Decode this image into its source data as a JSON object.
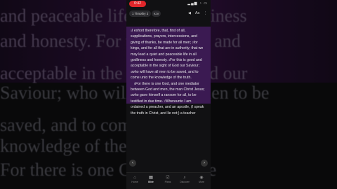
{
  "background": {
    "lines": [
      "and peaceable life in all godliness",
      "and honesty. For this is good and",
      "acceptable in the sight of God our",
      "Saviour; who will have all men to be",
      "saved, and to come unto the",
      "knowledge of the truth.",
      "For there is one God, and one"
    ]
  },
  "status": {
    "recording": "0:42",
    "icons": "▂▄▆ ◔ ▭"
  },
  "toolbar": {
    "reference": "1 Timothy 2",
    "version": "KJV",
    "icons": [
      "speaker-icon",
      "text-size-icon",
      "more-icon"
    ]
  },
  "verses": [
    {
      "num": "1",
      "text": "I exhort therefore, that, first of all, supplications, prayers, intercessions, and giving of thanks, be made for all men;"
    },
    {
      "num": "2",
      "text": "for kings, and for all that are in authority; that we may lead a quiet and peaceable life in all godliness and honesty."
    },
    {
      "num": "3",
      "text": "For this is good and acceptable in the sight of God our Saviour;"
    },
    {
      "num": "4",
      "text": "who will have all men to be saved, and to come unto the knowledge of the truth."
    },
    {
      "num": "5",
      "text": "For there is one God, and one mediator between God and men, the man Christ Jesus;"
    },
    {
      "num": "6",
      "text": "who gave himself a ransom for all, to be testified in due time."
    },
    {
      "num": "7",
      "text": "Whereunto I am ordained a preacher, and an apostle, (I speak the truth in Christ, and lie not;) a teacher"
    }
  ],
  "tabs": [
    {
      "label": "Home",
      "icon": "⌂"
    },
    {
      "label": "Bible",
      "icon": "▤"
    },
    {
      "label": "Plans",
      "icon": "☑"
    },
    {
      "label": "Discover",
      "icon": "⌕"
    },
    {
      "label": "More",
      "icon": "◉"
    }
  ],
  "colors": {
    "highlight": "#3b1a52",
    "recording": "#e0262a"
  }
}
